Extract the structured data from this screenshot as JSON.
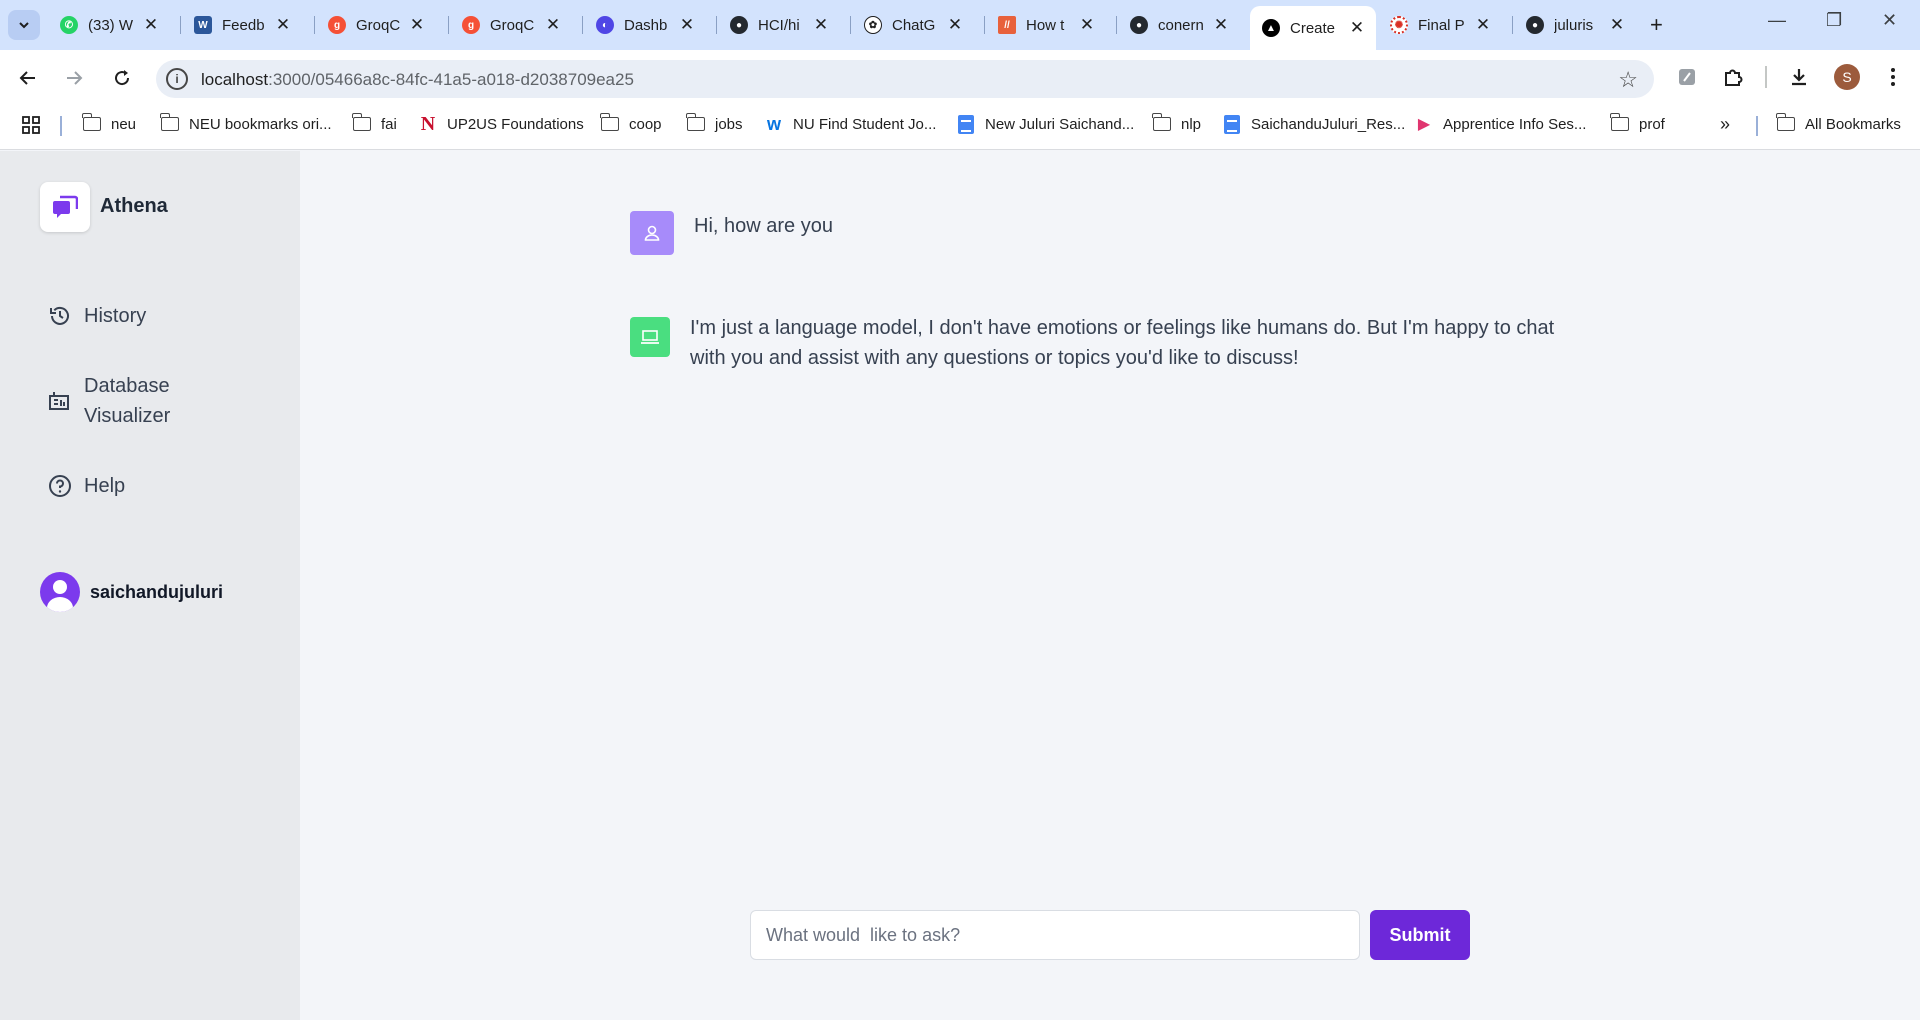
{
  "browser": {
    "tabs": [
      {
        "label": "(33) W",
        "icon": "whatsapp-icon",
        "color": "#25d366"
      },
      {
        "label": "Feedb",
        "icon": "word-icon",
        "color": "#2b579a"
      },
      {
        "label": "GroqC",
        "icon": "groq-icon",
        "color": "#f55036"
      },
      {
        "label": "GroqC",
        "icon": "groq-icon",
        "color": "#f55036"
      },
      {
        "label": "Dashb",
        "icon": "dashboard-icon",
        "color": "#4f46e5"
      },
      {
        "label": "HCI/hi",
        "icon": "github-icon",
        "color": "#24292f"
      },
      {
        "label": "ChatG",
        "icon": "openai-icon",
        "color": "#1f1f1f"
      },
      {
        "label": "How t",
        "icon": "stripes-icon",
        "color": "#e8613c"
      },
      {
        "label": "conern",
        "icon": "github-icon",
        "color": "#24292f"
      },
      {
        "label": "Create",
        "icon": "triangle-icon",
        "color": "#000000",
        "active": true
      },
      {
        "label": "Final P",
        "icon": "sun-icon",
        "color": "#d93025"
      },
      {
        "label": "juluris",
        "icon": "github-icon",
        "color": "#24292f"
      }
    ],
    "address": {
      "host": "localhost",
      "path": ":3000/05466a8c-84fc-41a5-a018-d2038709ea25"
    },
    "profile_initial": "S",
    "bookmarks": [
      {
        "label": "neu",
        "icon": "folder-icon"
      },
      {
        "label": "NEU bookmarks ori...",
        "icon": "folder-icon"
      },
      {
        "label": "fai",
        "icon": "folder-icon"
      },
      {
        "label": "UP2US Foundations",
        "icon": "northeastern-icon"
      },
      {
        "label": "coop",
        "icon": "folder-icon"
      },
      {
        "label": "jobs",
        "icon": "folder-icon"
      },
      {
        "label": "NU Find Student Jo...",
        "icon": "workday-icon"
      },
      {
        "label": "New Juluri Saichand...",
        "icon": "doc-icon"
      },
      {
        "label": "nlp",
        "icon": "folder-icon"
      },
      {
        "label": "SaichanduJuluri_Res...",
        "icon": "doc-icon"
      },
      {
        "label": "Apprentice Info Ses...",
        "icon": "play-icon"
      },
      {
        "label": "prof",
        "icon": "folder-icon"
      }
    ],
    "all_bookmarks": "All Bookmarks",
    "more_bookmarks": "»"
  },
  "app": {
    "name": "Athena",
    "accent": "#6d28d9",
    "nav": [
      {
        "label": "History",
        "icon": "history-icon"
      },
      {
        "label": "Database Visualizer",
        "icon": "database-icon"
      },
      {
        "label": "Help",
        "icon": "help-icon"
      }
    ],
    "user": {
      "name": "saichandujuluri"
    }
  },
  "chat": {
    "messages": [
      {
        "role": "user",
        "text": "Hi, how are you",
        "avatar_color": "#a78bfa"
      },
      {
        "role": "assistant",
        "text": "I'm just a language model, I don't have emotions or feelings like humans do. But I'm happy to chat with you and assist with any questions or topics you'd like to discuss!",
        "avatar_color": "#4ade80"
      }
    ],
    "input": {
      "placeholder": "What would  like to ask?",
      "value": ""
    },
    "submit_label": "Submit"
  }
}
